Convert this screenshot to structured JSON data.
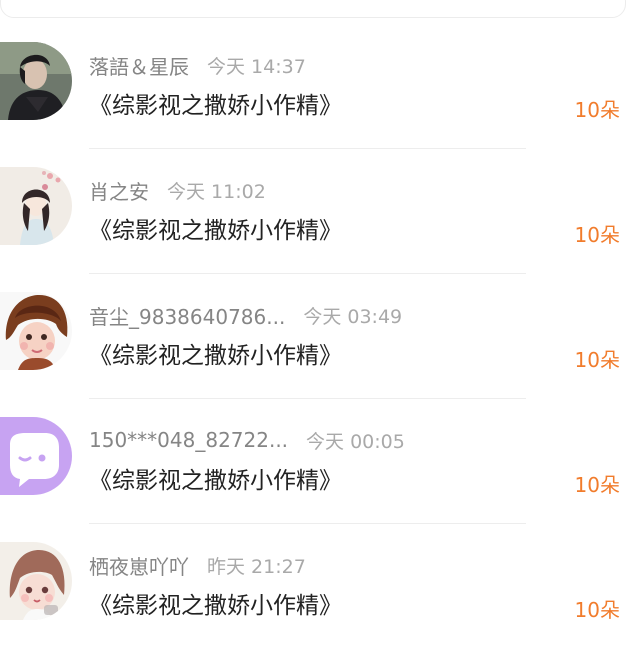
{
  "colors": {
    "accent_orange": "#f17c2c",
    "username_gray": "#858585",
    "timestamp_gray": "#a9a9a9",
    "title_black": "#222222",
    "divider": "#ededed"
  },
  "gift_records": [
    {
      "username": "落語＆星辰",
      "timestamp": "今天 14:37",
      "gift_title": "《综影视之撒娇小作精》",
      "gift_count": "10朵",
      "avatar_icon": "young-man-photo-avatar"
    },
    {
      "username": "肖之安",
      "timestamp": "今天 11:02",
      "gift_title": "《综影视之撒娇小作精》",
      "gift_count": "10朵",
      "avatar_icon": "ancient-style-girl-avatar"
    },
    {
      "username": "音尘_9838640786...",
      "timestamp": "今天 03:49",
      "gift_title": "《综影视之撒娇小作精》",
      "gift_count": "10朵",
      "avatar_icon": "cartoon-girl-avatar"
    },
    {
      "username": "150***048_82722...",
      "timestamp": "今天 00:05",
      "gift_title": "《综影视之撒娇小作精》",
      "gift_count": "10朵",
      "avatar_icon": "purple-chat-bubble-avatar"
    },
    {
      "username": "栖夜崽吖吖",
      "timestamp": "昨天 21:27",
      "gift_title": "《综影视之撒娇小作精》",
      "gift_count": "10朵",
      "avatar_icon": "anime-girl-avatar"
    }
  ]
}
